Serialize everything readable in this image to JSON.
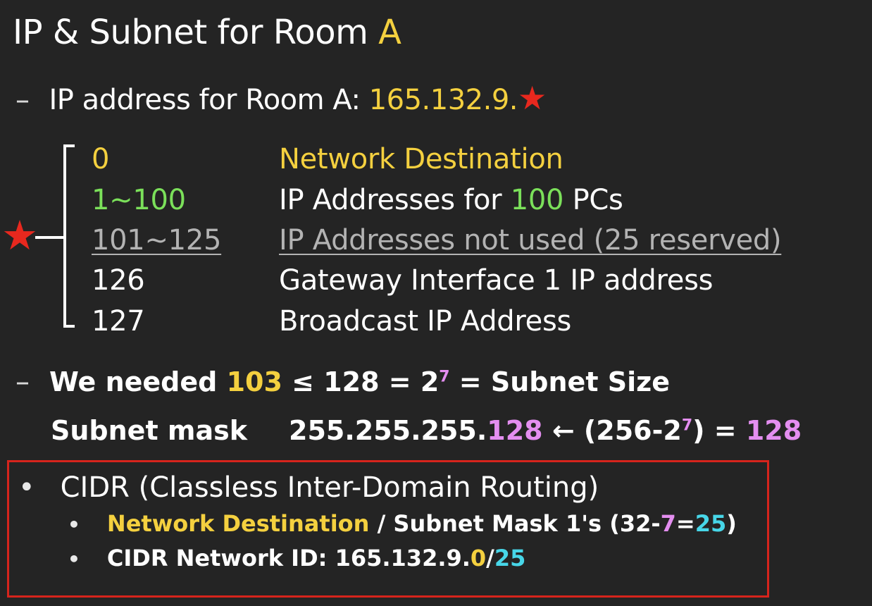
{
  "title": {
    "text": "IP & Subnet for Room ",
    "highlight": "A"
  },
  "ip_line": {
    "dash": "–",
    "label": "IP address for Room A: ",
    "value": "165.132.9.",
    "star": "★"
  },
  "ranges": [
    {
      "num": "0",
      "desc": "Network Destination"
    },
    {
      "num": "1~100",
      "desc_pre": "IP Addresses for ",
      "desc_hl": "100",
      "desc_post": " PCs"
    },
    {
      "num": "101~125",
      "desc": "IP Addresses not used (25 reserved)"
    },
    {
      "num": "126",
      "desc": "Gateway Interface 1 IP address"
    },
    {
      "num": "127",
      "desc": "Broadcast IP Address"
    }
  ],
  "left_star": "★",
  "needed": {
    "dash": "–",
    "pre": "We needed ",
    "hl": "103",
    "mid": " ≤ 128 = 2",
    "exp": "7",
    "post": " = Subnet Size"
  },
  "mask": {
    "label": "Subnet mask",
    "value_pre": "255.255.255.",
    "value_hl": "128",
    "arrow": " ← ",
    "formula_pre": "(256-2",
    "formula_exp": "7",
    "formula_post": ") = ",
    "result": "128"
  },
  "cidr": {
    "bullet": "•",
    "title": "CIDR (Classless Inter-Domain Routing)",
    "sub1": {
      "bullet": "•",
      "hl": "Network Destination",
      "mid": " / Subnet Mask 1's (32-",
      "seven": "7",
      "eq": "=",
      "result": "25",
      "close": ")"
    },
    "sub2": {
      "bullet": "•",
      "label": "CIDR Network ID:  ",
      "value_pre": "165.132.9.",
      "zero": "0",
      "slash": "/",
      "prefix": "25"
    }
  },
  "colors": {
    "background": "#242424",
    "yellow": "#f4d03f",
    "green": "#7be05a",
    "pink": "#e48ef0",
    "cyan": "#47d6e8",
    "red": "#d6241c"
  }
}
